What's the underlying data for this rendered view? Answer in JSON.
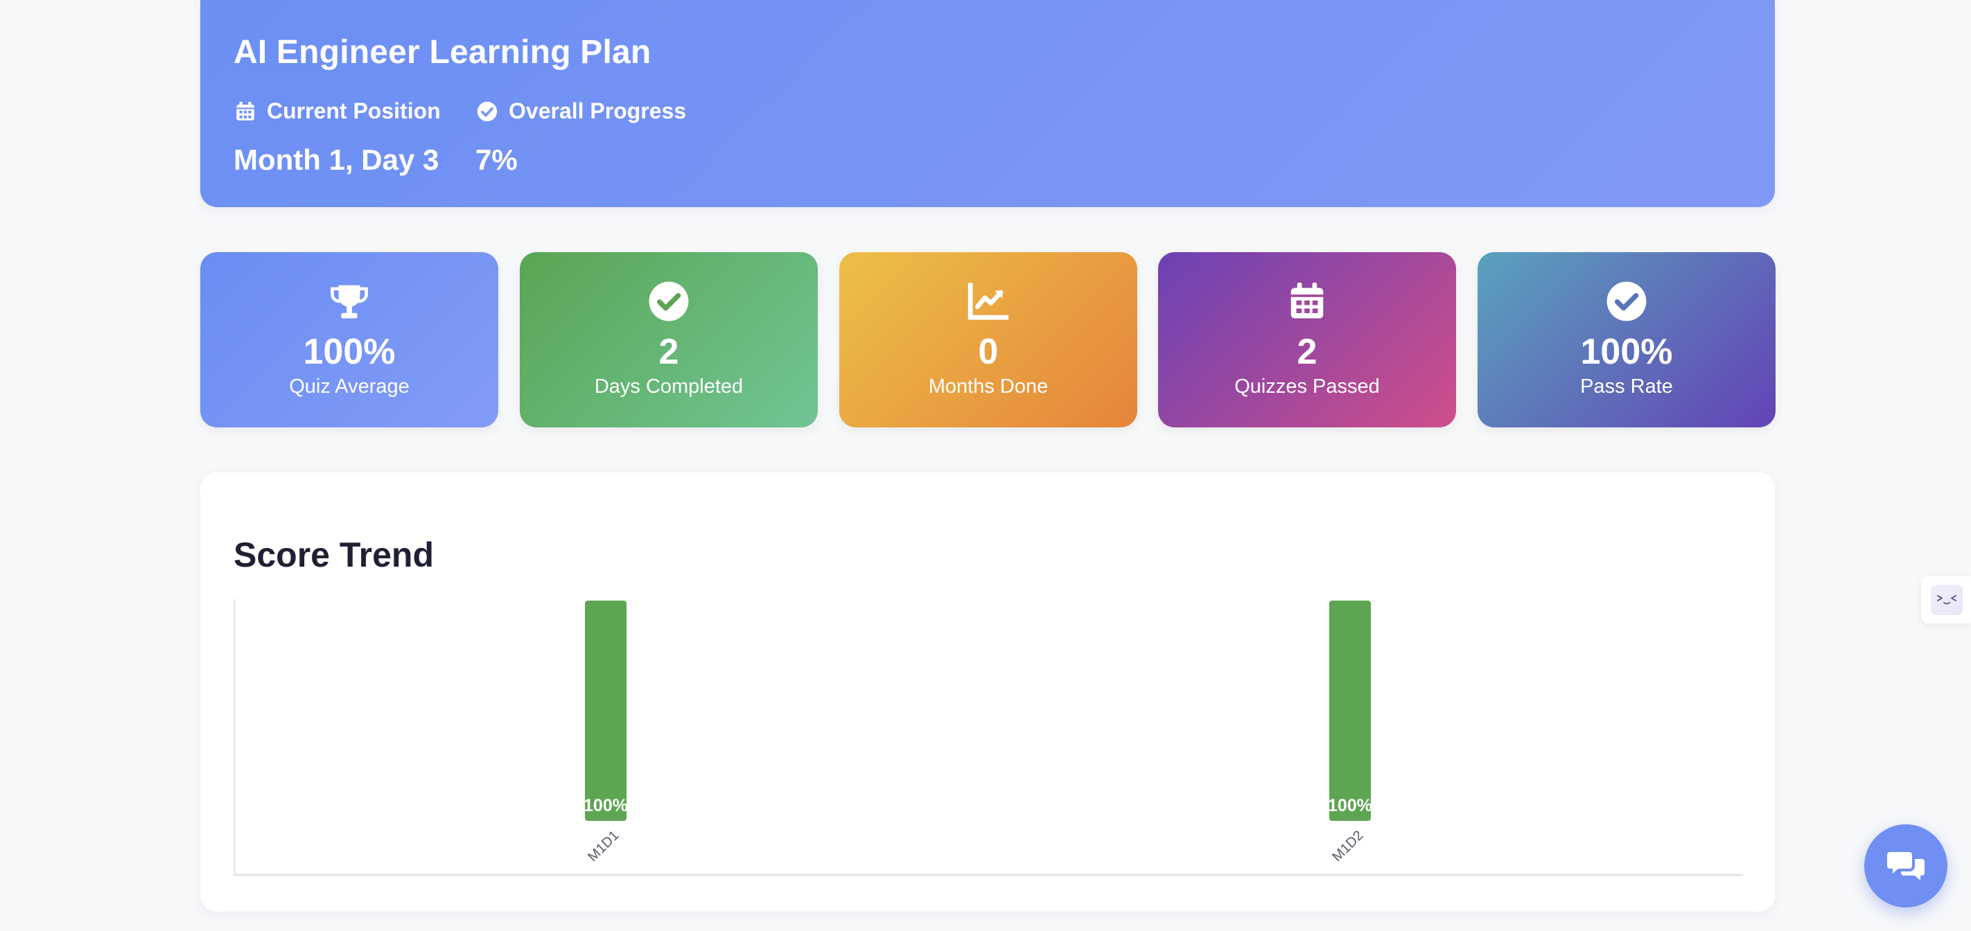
{
  "header": {
    "title": "AI Engineer Learning Plan",
    "current_position_label": "Current Position",
    "current_position_value": "Month 1, Day 3",
    "overall_progress_label": "Overall Progress",
    "overall_progress_value": "7%"
  },
  "stats": [
    {
      "icon": "trophy-icon",
      "value": "100%",
      "label": "Quiz Average"
    },
    {
      "icon": "check-circle-icon",
      "value": "2",
      "label": "Days Completed"
    },
    {
      "icon": "chart-line-icon",
      "value": "0",
      "label": "Months Done"
    },
    {
      "icon": "calendar-icon",
      "value": "2",
      "label": "Quizzes Passed"
    },
    {
      "icon": "check-circle-icon",
      "value": "100%",
      "label": "Pass Rate"
    }
  ],
  "score_trend": {
    "title": "Score Trend"
  },
  "chart_data": {
    "type": "bar",
    "categories": [
      "M1D1",
      "M1D2"
    ],
    "values": [
      100,
      100
    ],
    "data_labels": [
      "100%",
      "100%"
    ],
    "ylim": [
      0,
      100
    ],
    "bar_color": "#5ea553",
    "grid": false
  },
  "colors": {
    "header_gradient_start": "#6c8ff4",
    "header_gradient_end": "#8199f6",
    "bar": "#5ea553",
    "chat_button": "#6f8ff2"
  },
  "widgets": {
    "side_tab_icon": "code-face-icon",
    "chat_icon": "chat-bubbles-icon"
  }
}
